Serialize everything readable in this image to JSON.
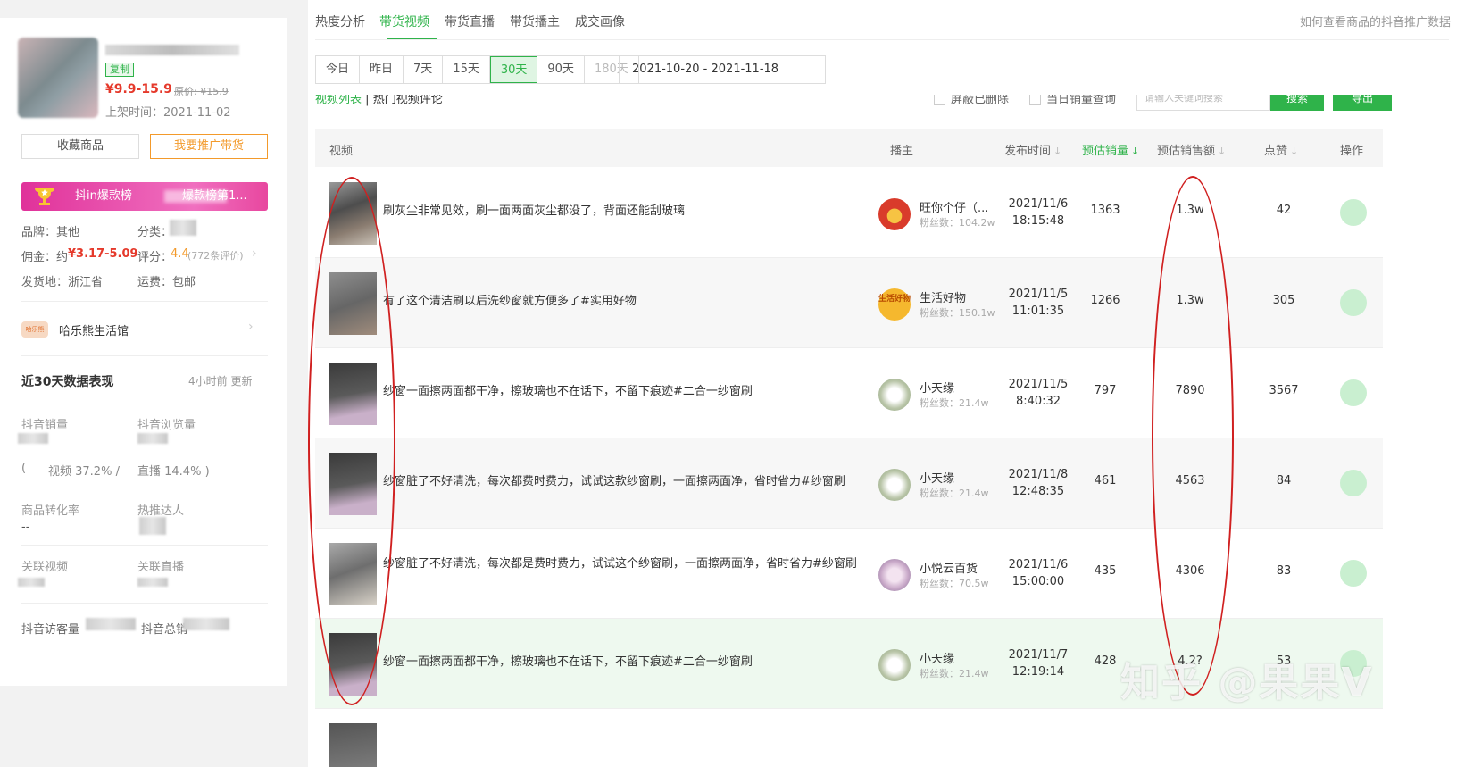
{
  "product": {
    "copy_tag": "复制",
    "price": "¥9.9-15.9",
    "original_price": "原价: ¥15.9",
    "shelf_time": "上架时间：2021-11-02",
    "fav_button": "收藏商品",
    "promote_button": "我要推广带货",
    "rank_banner_prefix": "抖in爆款榜",
    "rank_banner_suffix": "爆款榜第1...",
    "brand": "品牌：其他",
    "category": "分类：",
    "commission_label": "佣金：约",
    "commission_value": "¥3.17-5.09",
    "score_label": "评分：",
    "score_value": "4.4",
    "score_count": "(772条评价)",
    "ship_from": "发货地：浙江省",
    "shipping": "运费：包邮",
    "shop_logo_text": "哈乐熊",
    "shop_name": "哈乐熊生活馆"
  },
  "stats": {
    "title": "近30天数据表现",
    "update": "4小时前 更新",
    "douyin_sales": "抖音销量",
    "douyin_views": "抖音浏览量",
    "ratio_open": "(",
    "video_ratio": "视频 37.2% /",
    "live_ratio": "直播 14.4% )",
    "conversion": "商品转化率",
    "conversion_value": "--",
    "hot_promoters": "热推达人",
    "related_videos": "关联视频",
    "related_lives": "关联直播",
    "visitors": "抖音访客量",
    "total": "抖音总销"
  },
  "tabs": [
    "热度分析",
    "带货视频",
    "带货直播",
    "带货播主",
    "成交画像"
  ],
  "help_link": "如何查看商品的抖音推广数据",
  "ranges": [
    "今日",
    "昨日",
    "7天",
    "15天",
    "30天",
    "90天",
    "180天"
  ],
  "date_range": "2021-10-20  -  2021-11-18",
  "subbar": {
    "video_list": "视频列表",
    "sep": "|",
    "hot_comments": "热门视频评论",
    "block_deleted": "屏蔽已删除",
    "daily_sales_query": "当日销量查询",
    "search_placeholder": "请输入关键词搜索",
    "search_btn": "搜索",
    "export_btn": "导出"
  },
  "table": {
    "headers": {
      "video": "视频",
      "anchor": "播主",
      "publish_time": "发布时间",
      "est_sales": "预估销量",
      "est_amount": "预估销售额",
      "likes": "点赞",
      "ops": "操作"
    },
    "rows": [
      {
        "title": "刷灰尘非常见效，刷一面两面灰尘都没了，背面还能刮玻璃",
        "anchor": "旺你个仔（...",
        "fans": "粉丝数：104.2w",
        "date": "2021/11/6",
        "time": "18:15:48",
        "sales": "1363",
        "amount": "1.3w",
        "likes": "42"
      },
      {
        "title": "有了这个清洁刷以后洗纱窗就方便多了#实用好物",
        "anchor": "生活好物",
        "avatar_text": "生活好物",
        "fans": "粉丝数：150.1w",
        "date": "2021/11/5",
        "time": "11:01:35",
        "sales": "1266",
        "amount": "1.3w",
        "likes": "305"
      },
      {
        "title": "纱窗一面擦两面都干净，擦玻璃也不在话下，不留下痕迹#二合一纱窗刷",
        "anchor": "小天缘",
        "fans": "粉丝数：21.4w",
        "date": "2021/11/5",
        "time": "8:40:32",
        "sales": "797",
        "amount": "7890",
        "likes": "3567"
      },
      {
        "title": "纱窗脏了不好清洗，每次都费时费力，试试这款纱窗刷，一面擦两面净，省时省力#纱窗刷",
        "anchor": "小天缘",
        "fans": "粉丝数：21.4w",
        "date": "2021/11/8",
        "time": "12:48:35",
        "sales": "461",
        "amount": "4563",
        "likes": "84"
      },
      {
        "title": "纱窗脏了不好清洗，每次都是费时费力，试试这个纱窗刷，一面擦两面净，省时省力#纱窗刷",
        "anchor": "小悦云百货",
        "fans": "粉丝数：70.5w",
        "date": "2021/11/6",
        "time": "15:00:00",
        "sales": "435",
        "amount": "4306",
        "likes": "83"
      },
      {
        "title": "纱窗一面擦两面都干净，擦玻璃也不在话下，不留下痕迹#二合一纱窗刷",
        "anchor": "小天缘",
        "fans": "粉丝数：21.4w",
        "date": "2021/11/7",
        "time": "12:19:14",
        "sales": "428",
        "amount": "4.2?",
        "likes": "53"
      }
    ]
  },
  "watermark": "知乎 @果果V",
  "colors": {
    "accent": "#2fb34a",
    "price_red": "#e5392b",
    "annotation_red": "#d02020",
    "orange": "#f39a2b",
    "pink": "#e0329a"
  }
}
